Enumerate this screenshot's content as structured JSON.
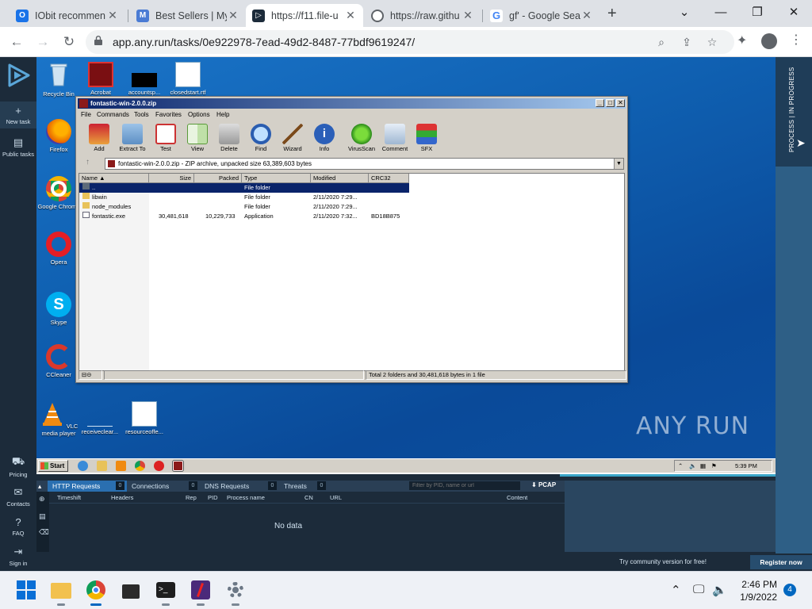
{
  "browser": {
    "tabs": [
      {
        "title": "IObit recommen",
        "favicon": "browser-tab-icon",
        "color": "#1a73e8"
      },
      {
        "title": "Best Sellers | My",
        "favicon": "browser-tab-icon",
        "color": "#4a7bd4"
      },
      {
        "title": "https://f11.file-u",
        "favicon": "anyrun-tab-icon",
        "color": "#1c2b3a"
      },
      {
        "title": "https://raw.githu",
        "favicon": "globe-tab-icon",
        "color": "#5f6368"
      },
      {
        "title": "gf' - Google Sea",
        "favicon": "google-tab-icon",
        "color": "#4285f4"
      }
    ],
    "url": "app.any.run/tasks/0e922978-7ead-49d2-8487-77bdf9619247/"
  },
  "anyrun_sidebar": {
    "items": [
      {
        "label": "New task",
        "icon": "plus-icon"
      },
      {
        "label": "Public tasks",
        "icon": "document-icon"
      },
      {
        "label": "Pricing",
        "icon": "cart-icon"
      },
      {
        "label": "Contacts",
        "icon": "mail-icon"
      },
      {
        "label": "FAQ",
        "icon": "question-icon"
      },
      {
        "label": "Sign in",
        "icon": "signin-icon"
      }
    ]
  },
  "desktop": {
    "icons": [
      {
        "label": "Recycle Bin"
      },
      {
        "label": "Acrobat"
      },
      {
        "label": "accountsp..."
      },
      {
        "label": "closedstart.rtf"
      },
      {
        "label": "Firefox"
      },
      {
        "label": "Google Chrome"
      },
      {
        "label": "Opera"
      },
      {
        "label": "Skype"
      },
      {
        "label": "CCleaner"
      },
      {
        "label": "VLC media player"
      },
      {
        "label": "receiveclear..."
      },
      {
        "label": "resourceoffe..."
      }
    ],
    "watermark": "ANY RUN"
  },
  "process_panel": {
    "label": "PROCESS | IN PROGRESS"
  },
  "winrar": {
    "title": "fontastic-win-2.0.0.zip",
    "menu": [
      "File",
      "Commands",
      "Tools",
      "Favorites",
      "Options",
      "Help"
    ],
    "toolbar": [
      "Add",
      "Extract To",
      "Test",
      "View",
      "Delete",
      "Find",
      "Wizard",
      "Info",
      "VirusScan",
      "Comment",
      "SFX"
    ],
    "address": "fontastic-win-2.0.0.zip - ZIP archive, unpacked size 63,389,603 bytes",
    "columns": [
      "Name",
      "Size",
      "Packed",
      "Type",
      "Modified",
      "CRC32"
    ],
    "rows": [
      {
        "name": "..",
        "size": "",
        "packed": "",
        "type": "File folder",
        "modified": "",
        "crc": ""
      },
      {
        "name": "libwin",
        "size": "",
        "packed": "",
        "type": "File folder",
        "modified": "2/11/2020 7:29...",
        "crc": ""
      },
      {
        "name": "node_modules",
        "size": "",
        "packed": "",
        "type": "File folder",
        "modified": "2/11/2020 7:29...",
        "crc": ""
      },
      {
        "name": "fontastic.exe",
        "size": "30,481,618",
        "packed": "10,229,733",
        "type": "Application",
        "modified": "2/11/2020 7:32...",
        "crc": "BD18B875"
      }
    ],
    "status": "Total 2 folders and 30,481,618 bytes in 1 file"
  },
  "vm_taskbar": {
    "start": "Start",
    "time": "5:39 PM"
  },
  "network": {
    "tabs": [
      {
        "label": "HTTP Requests",
        "count": "0"
      },
      {
        "label": "Connections",
        "count": "0"
      },
      {
        "label": "DNS Requests",
        "count": "0"
      },
      {
        "label": "Threats",
        "count": "0"
      }
    ],
    "filter_placeholder": "Filter by PID, name or url",
    "pcap": "PCAP",
    "columns": [
      "Timeshift",
      "Headers",
      "Rep",
      "PID",
      "Process name",
      "CN",
      "URL",
      "Content"
    ],
    "empty": "No data"
  },
  "footer": {
    "try": "Try community version for free!",
    "register": "Register now"
  },
  "taskbar": {
    "time": "2:46 PM",
    "date": "1/9/2022",
    "notifications": "4"
  }
}
